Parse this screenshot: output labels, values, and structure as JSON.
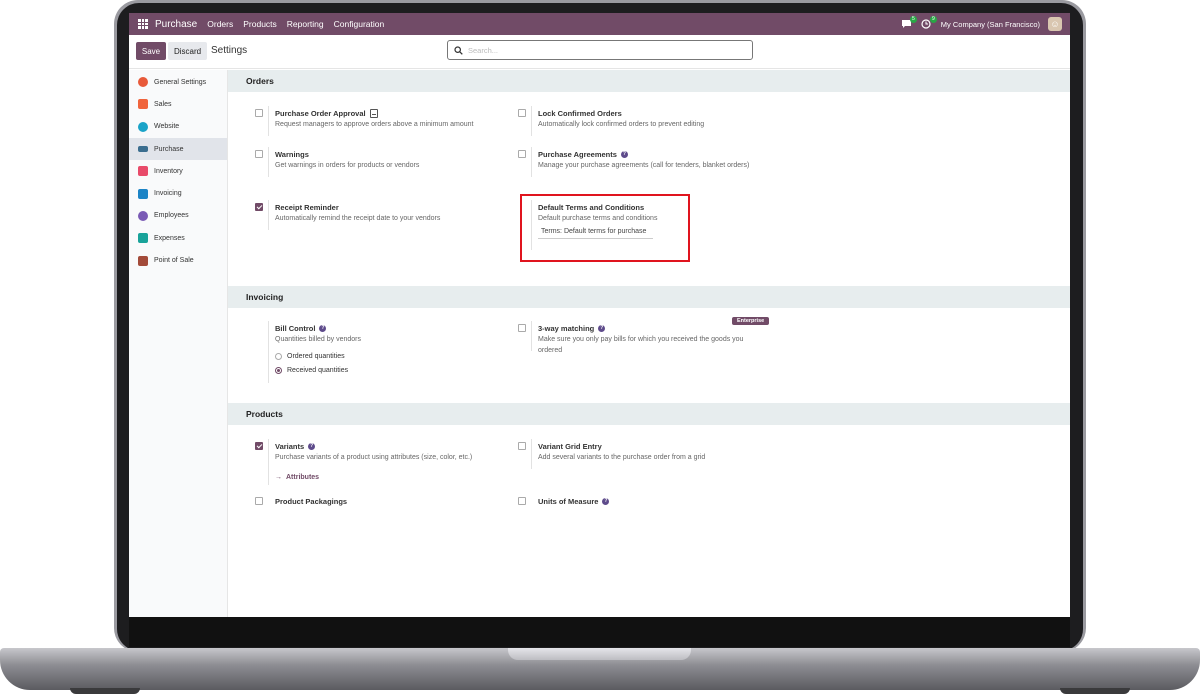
{
  "navbar": {
    "brand": "Purchase",
    "menu": [
      "Orders",
      "Products",
      "Reporting",
      "Configuration"
    ],
    "chat_count": "5",
    "activity_count": "9",
    "company": "My Company (San Francisco)"
  },
  "control": {
    "save_label": "Save",
    "discard_label": "Discard",
    "title": "Settings",
    "search_placeholder": "Search..."
  },
  "sidebar": {
    "items": [
      {
        "label": "General Settings",
        "color": "#e85a3a"
      },
      {
        "label": "Sales",
        "color": "#f0643c"
      },
      {
        "label": "Website",
        "color": "#1aa3c8"
      },
      {
        "label": "Purchase",
        "color": "#3b6e8f"
      },
      {
        "label": "Inventory",
        "color": "#e84b6a"
      },
      {
        "label": "Invoicing",
        "color": "#1c84c6"
      },
      {
        "label": "Employees",
        "color": "#7a5ab5"
      },
      {
        "label": "Expenses",
        "color": "#19a39a"
      },
      {
        "label": "Point of Sale",
        "color": "#a34b3a"
      }
    ]
  },
  "sections": {
    "orders": {
      "title": "Orders",
      "po_approval": {
        "title": "Purchase Order Approval",
        "desc": "Request managers to approve orders above a minimum amount"
      },
      "lock_orders": {
        "title": "Lock Confirmed Orders",
        "desc": "Automatically lock confirmed orders to prevent editing"
      },
      "warnings": {
        "title": "Warnings",
        "desc": "Get warnings in orders for products or vendors"
      },
      "agreements": {
        "title": "Purchase Agreements",
        "desc": "Manage your purchase agreements (call for tenders, blanket orders)"
      },
      "receipt": {
        "title": "Receipt Reminder",
        "desc": "Automatically remind the receipt date to your vendors"
      },
      "terms": {
        "title": "Default Terms and Conditions",
        "desc": "Default purchase terms and conditions",
        "value": "Terms: Default terms for purchase"
      }
    },
    "invoicing": {
      "title": "Invoicing",
      "bill_control": {
        "title": "Bill Control",
        "desc": "Quantities billed by vendors",
        "options": [
          "Ordered quantities",
          "Received quantities"
        ]
      },
      "three_way": {
        "title": "3-way matching",
        "desc": "Make sure you only pay bills for which you received the goods you ordered",
        "badge": "Enterprise"
      }
    },
    "products": {
      "title": "Products",
      "variants": {
        "title": "Variants",
        "desc": "Purchase variants of a product using attributes (size, color, etc.)",
        "link": "Attributes"
      },
      "grid_entry": {
        "title": "Variant Grid Entry",
        "desc": "Add several variants to the purchase order from a grid"
      },
      "packagings": {
        "title": "Product Packagings"
      },
      "uom": {
        "title": "Units of Measure"
      }
    }
  }
}
